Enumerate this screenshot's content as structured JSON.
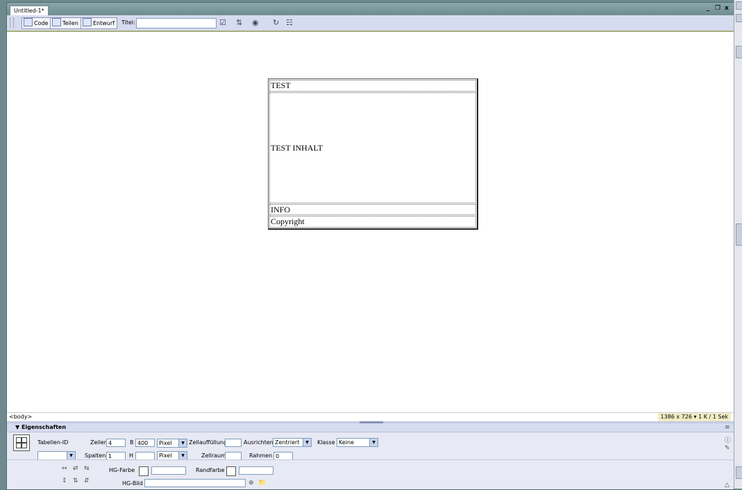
{
  "document": {
    "tab_title": "Untitled-1*"
  },
  "window_controls": {
    "minimize": "_",
    "restore": "́",
    "close": "x"
  },
  "toolbar": {
    "code_label": "Code",
    "split_label": "Teilen",
    "design_label": "Entwurf",
    "title_label": "Titel:",
    "title_value": ""
  },
  "page_table": {
    "rows": [
      "TEST",
      "TEST INHALT",
      "INFO",
      "Copyright"
    ]
  },
  "status": {
    "tag_selector": "<body>",
    "window_size": "1386 x 726 ▾ 1 K / 1 Sek"
  },
  "properties": {
    "title": "▼ Eigenschaften",
    "table_id_label": "Tabellen-ID",
    "table_id_value": "",
    "rows_label": "Zeilen",
    "rows_value": "4",
    "width_label": "B",
    "width_value": "400",
    "width_unit": "Pixel",
    "cellpad_label": "Zellauffüllung",
    "cellpad_value": "",
    "align_label": "Ausrichten",
    "align_value": "Zentriert",
    "class_label": "Klasse",
    "class_value": "Keine",
    "cols_label": "Spalten",
    "cols_value": "1",
    "height_label": "H",
    "height_value": "",
    "height_unit": "Pixel",
    "cellspace_label": "Zellraum",
    "cellspace_value": "",
    "border_label": "Rahmen",
    "border_value": "0",
    "bgcolor_label": "HG-Farbe",
    "bgcolor_value": "",
    "bordercolor_label": "Randfarbe",
    "bordercolor_value": "",
    "bgimage_label": "HG-Bild",
    "bgimage_value": ""
  }
}
